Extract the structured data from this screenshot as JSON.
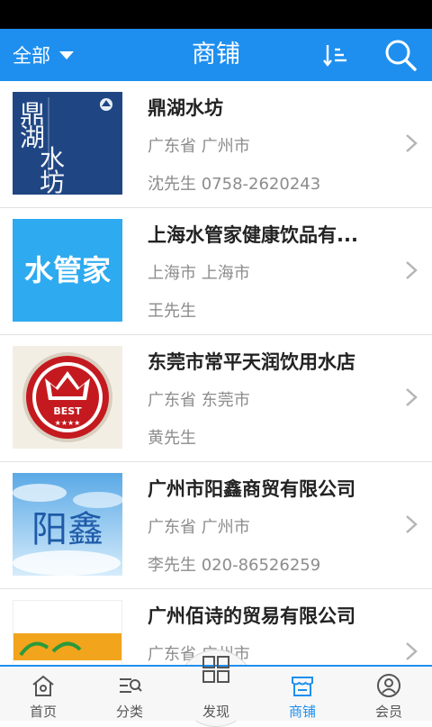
{
  "header": {
    "filter_label": "全部",
    "title": "商铺"
  },
  "shops": [
    {
      "name": "鼎湖水坊",
      "region": "广东省 广州市",
      "contact": "沈先生 0758-2620243",
      "logo_text": "鼎湖水坊"
    },
    {
      "name": "上海水管家健康饮品有...",
      "region": "上海市 上海市",
      "contact": "王先生",
      "logo_text": "水管家"
    },
    {
      "name": "东莞市常平天润饮用水店",
      "region": "广东省 东莞市",
      "contact": "黄先生",
      "logo_text": "BEST"
    },
    {
      "name": "广州市阳鑫商贸有限公司",
      "region": "广东省 广州市",
      "contact": "李先生 020-86526259",
      "logo_text": "阳鑫"
    },
    {
      "name": "广州佰诗的贸易有限公司",
      "region": "广东省 广州市",
      "contact": ""
    }
  ],
  "tabbar": {
    "tabs": [
      {
        "label": "首页",
        "icon": "home-icon"
      },
      {
        "label": "分类",
        "icon": "category-icon"
      },
      {
        "label": "发现",
        "icon": "grid-icon"
      },
      {
        "label": "商铺",
        "icon": "store-icon"
      },
      {
        "label": "会员",
        "icon": "user-icon"
      }
    ],
    "active_index": 3
  },
  "colors": {
    "brand": "#1E8FEF",
    "text": "#222222",
    "muted": "#8C8C8C"
  }
}
